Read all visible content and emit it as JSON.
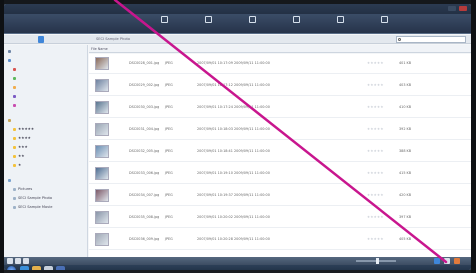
{
  "window": {
    "title": "",
    "menu": [
      "",
      "",
      "",
      "",
      "",
      ""
    ]
  },
  "toolbar": {
    "items": [
      {
        "icon": "import-icon",
        "label": ""
      },
      {
        "icon": "slideshow-icon",
        "label": ""
      },
      {
        "icon": "print-icon",
        "label": ""
      },
      {
        "icon": "edit-icon",
        "label": ""
      },
      {
        "icon": "share-icon",
        "label": ""
      },
      {
        "icon": "burn-icon",
        "label": ""
      }
    ]
  },
  "tabs": {
    "active_label": "",
    "other_label": ""
  },
  "breadcrumb": "SECI Sample Photo",
  "search": {
    "placeholder": ""
  },
  "sidebar": {
    "items": [
      {
        "label": "",
        "color": "#6f87a7",
        "head": true
      },
      {
        "label": "",
        "color": "#5d8fcf",
        "head": true
      },
      {
        "label": "",
        "color": "#d9534f"
      },
      {
        "label": "",
        "color": "#5cb85c"
      },
      {
        "label": "",
        "color": "#f0ad4e"
      },
      {
        "label": "",
        "color": "#7b5bc4"
      },
      {
        "label": "",
        "color": "#c94db0"
      },
      {
        "label": "",
        "color": "#c9a85a",
        "head": true
      },
      {
        "label": "★★★★★",
        "color": "#f3c23a"
      },
      {
        "label": "★★★★",
        "color": "#f3c23a"
      },
      {
        "label": "★★★",
        "color": "#f3c23a"
      },
      {
        "label": "★★",
        "color": "#f3c23a"
      },
      {
        "label": "★",
        "color": "#f3c23a"
      },
      {
        "label": "",
        "color": "#7aa3cf",
        "head": true
      },
      {
        "label": "Pictures",
        "color": "#9db2c8"
      },
      {
        "label": "SECI Sample Photo",
        "color": "#9db2c8"
      },
      {
        "label": "SECI Sample Movie",
        "color": "#9db2c8"
      }
    ]
  },
  "columns": [
    "File Name",
    "",
    "",
    "",
    "",
    "",
    "",
    "",
    "",
    "",
    ""
  ],
  "rows": [
    {
      "name": "DSC0028_001.jpg",
      "type": "JPEG",
      "date1": "2007/09/01 10:17:09",
      "date2": "2009/09/11 11:00:00",
      "size": "401 KB",
      "thumb_color": "#8a6a5a"
    },
    {
      "name": "DSC0029_002.jpg",
      "type": "JPEG",
      "date1": "2007/09/01 10:17:12",
      "date2": "2009/09/11 11:00:00",
      "size": "403 KB",
      "thumb_color": "#6e82a0"
    },
    {
      "name": "DSC0030_003.jpg",
      "type": "JPEG",
      "date1": "2007/09/01 10:17:24",
      "date2": "2009/09/11 11:00:00",
      "size": "410 KB",
      "thumb_color": "#5a7690"
    },
    {
      "name": "DSC0031_004.jpg",
      "type": "JPEG",
      "date1": "2007/09/01 10:18:03",
      "date2": "2009/09/11 11:00:00",
      "size": "392 KB",
      "thumb_color": "#9aa6b4"
    },
    {
      "name": "DSC0032_005.jpg",
      "type": "JPEG",
      "date1": "2007/09/01 10:18:41",
      "date2": "2009/09/11 11:00:00",
      "size": "388 KB",
      "thumb_color": "#6b8fb3"
    },
    {
      "name": "DSC0033_006.jpg",
      "type": "JPEG",
      "date1": "2007/09/01 10:19:10",
      "date2": "2009/09/11 11:00:00",
      "size": "415 KB",
      "thumb_color": "#4f6e92"
    },
    {
      "name": "DSC0034_007.jpg",
      "type": "JPEG",
      "date1": "2007/09/01 10:19:37",
      "date2": "2009/09/11 11:00:00",
      "size": "420 KB",
      "thumb_color": "#7d5a68"
    },
    {
      "name": "DSC0035_008.jpg",
      "type": "JPEG",
      "date1": "2007/09/01 10:20:02",
      "date2": "2009/09/11 11:00:00",
      "size": "397 KB",
      "thumb_color": "#8a96a8"
    },
    {
      "name": "DSC0036_009.jpg",
      "type": "JPEG",
      "date1": "2007/09/01 10:20:28",
      "date2": "2009/09/11 11:00:00",
      "size": "405 KB",
      "thumb_color": "#a0a9b6"
    }
  ],
  "star_glyphs": "★★★★★",
  "taskbar": {
    "tray": "",
    "clock": ""
  },
  "colors": {
    "annotation": "#c8168e",
    "accent": "#3f86d9"
  }
}
